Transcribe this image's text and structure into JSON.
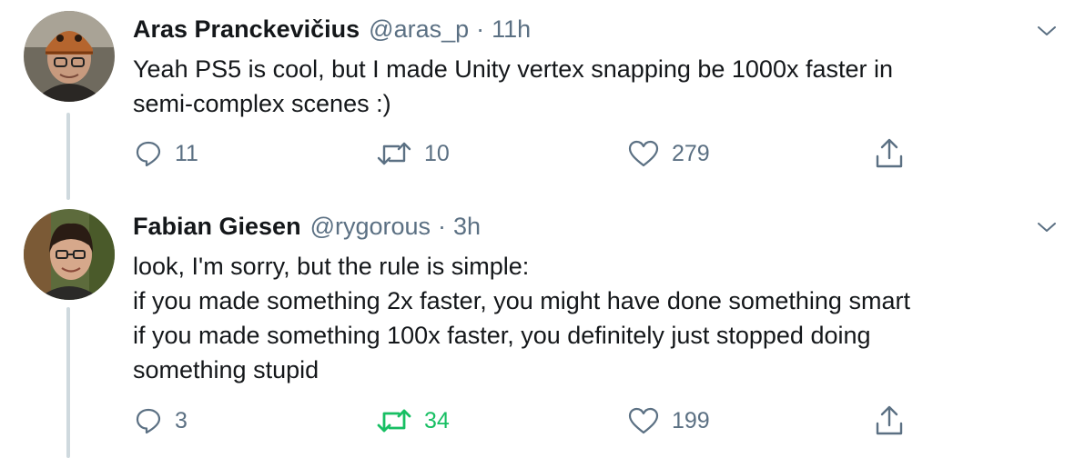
{
  "tweets": [
    {
      "author_name": "Aras Pranckevičius",
      "handle": "@aras_p",
      "separator": "·",
      "time": "11h",
      "text_lines": [
        "Yeah PS5 is cool, but I made Unity vertex snapping be 1000x faster in",
        "semi-complex scenes :)"
      ],
      "replies": "11",
      "retweets": "10",
      "likes": "279",
      "retweeted": false
    },
    {
      "author_name": "Fabian Giesen",
      "handle": "@rygorous",
      "separator": "·",
      "time": "3h",
      "text_lines": [
        "look, I'm sorry, but the rule is simple:",
        "if you made something 2x faster, you might have done something smart",
        "if you made something 100x faster, you definitely just stopped doing",
        "something stupid"
      ],
      "replies": "3",
      "retweets": "34",
      "likes": "199",
      "retweeted": true
    }
  ],
  "icons": {
    "reply": "reply-icon",
    "retweet": "retweet-icon",
    "like": "like-icon",
    "share": "share-icon",
    "more": "chevron-down-icon"
  },
  "colors": {
    "text": "#14171a",
    "secondary": "#5b7083",
    "retweet_active": "#17bf63",
    "thread_line": "#cfd9de"
  }
}
